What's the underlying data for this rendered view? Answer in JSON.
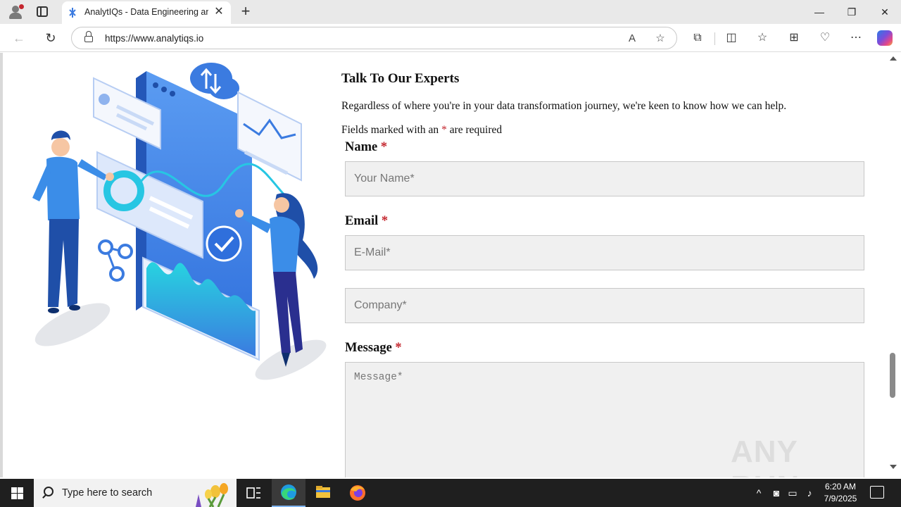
{
  "browser": {
    "tab_title": "AnalytIQs - Data Engineering and",
    "tab_close": "✕",
    "new_tab": "+",
    "url": "https://www.analytiqs.io",
    "window_controls": {
      "minimize": "—",
      "restore": "❐",
      "close": "✕"
    }
  },
  "page": {
    "title": "Talk To Our Experts",
    "intro": "Regardless of where you're in your data transformation journey, we're keen to know how we can help.",
    "required_note_before": "Fields marked with an",
    "required_star": "*",
    "required_note_after": "are required",
    "fields": {
      "name": {
        "label": "Name",
        "star": "*",
        "placeholder": "Your Name*"
      },
      "email": {
        "label": "Email",
        "star": "*",
        "placeholder": "E-Mail*"
      },
      "company": {
        "placeholder": "Company*"
      },
      "message": {
        "label": "Message",
        "star": "*",
        "placeholder": "Message*"
      }
    },
    "watermark": "ANY RUN"
  },
  "taskbar": {
    "search_placeholder": "Type here to search",
    "time": "6:20 AM",
    "date": "7/9/2025"
  },
  "icons": {
    "browser": [
      "profile-icon",
      "tab-actions-icon",
      "edge-favicon",
      "back-icon",
      "refresh-icon",
      "lock-icon",
      "read-aloud-icon",
      "favorite-star-icon",
      "extensions-icon",
      "split-screen-icon",
      "favorites-icon",
      "collections-icon",
      "browser-essentials-icon",
      "more-icon",
      "copilot-icon"
    ],
    "taskbar": [
      "windows-start-icon",
      "search-icon",
      "task-view-icon",
      "edge-icon",
      "file-explorer-icon",
      "firefox-icon",
      "tray-chevron-icon",
      "meet-now-icon",
      "network-icon",
      "volume-icon",
      "notifications-icon"
    ]
  },
  "colors": {
    "required_star": "#c4262e",
    "field_background": "#f0f0f0",
    "taskbar": "#1f1f1f",
    "illustration_blue": "#3b7be0"
  }
}
